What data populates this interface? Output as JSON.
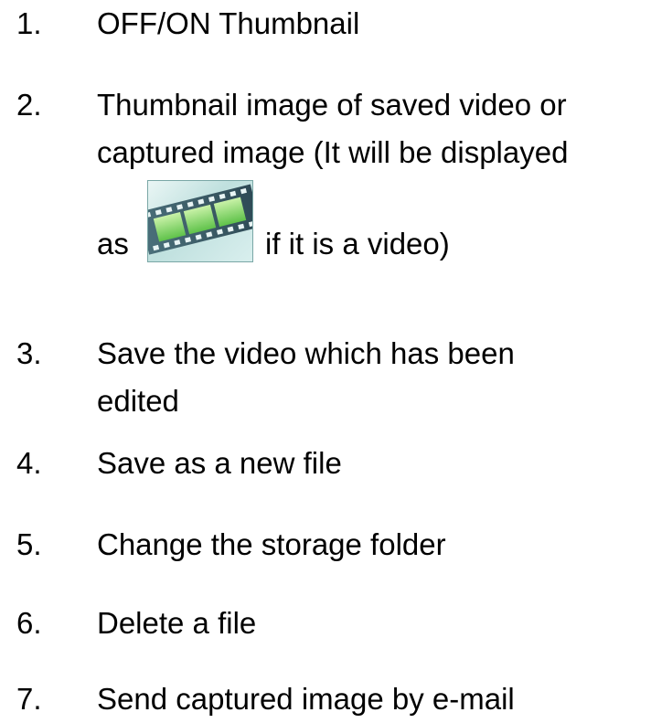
{
  "items": [
    {
      "num": "1.",
      "lines": [
        "OFF/ON Thumbnail"
      ]
    },
    {
      "num": "2.",
      "lines": [
        "Thumbnail image of saved video or",
        "captured image (It will be displayed"
      ],
      "icon_line": {
        "before": "as",
        "after": "if it is a video)",
        "icon": "film-strip-icon"
      }
    },
    {
      "num": "3.",
      "lines": [
        "Save the video which has been",
        "edited"
      ]
    },
    {
      "num": "4.",
      "lines": [
        "Save as a new file"
      ]
    },
    {
      "num": "5.",
      "lines": [
        "Change the storage folder"
      ]
    },
    {
      "num": "6.",
      "lines": [
        "Delete a file"
      ]
    },
    {
      "num": "7.",
      "lines": [
        "Send captured image by e-mail"
      ]
    }
  ]
}
